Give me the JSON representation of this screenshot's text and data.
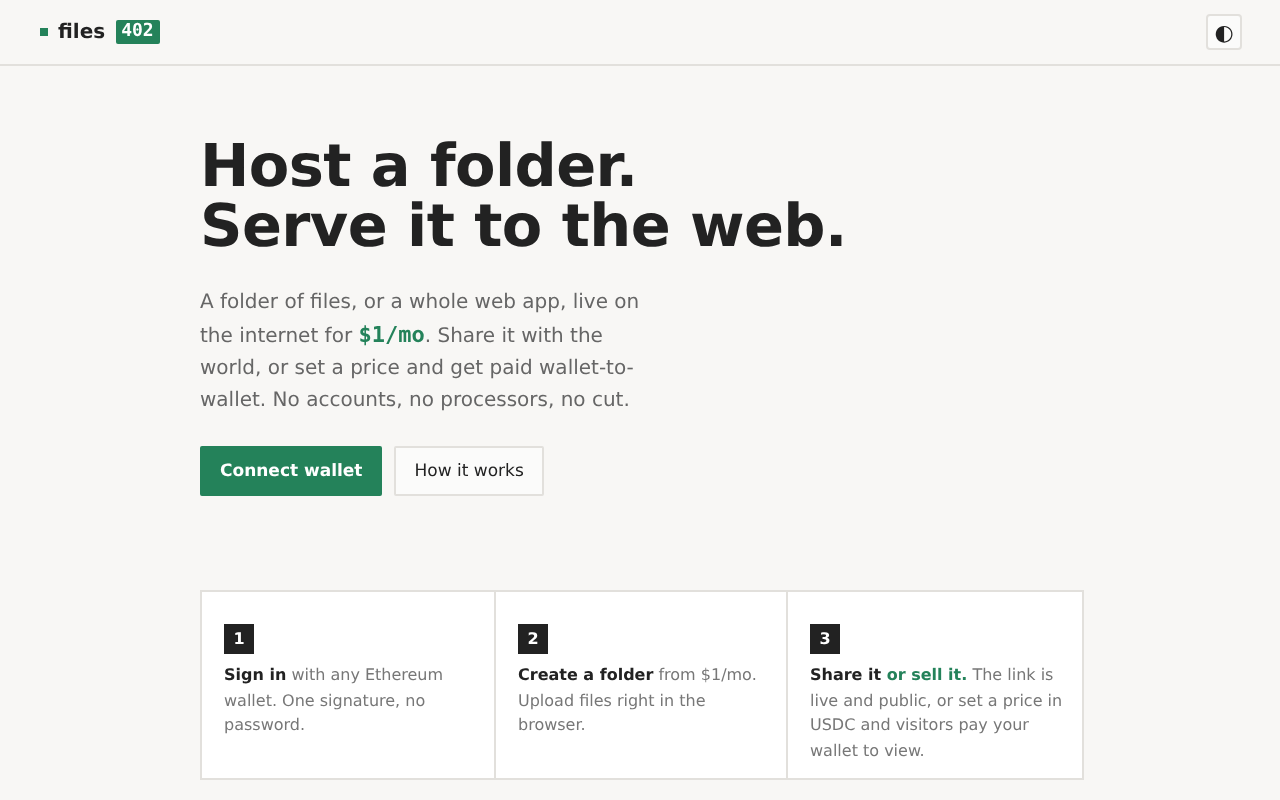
{
  "header": {
    "brand": "files",
    "badge": "402",
    "theme_toggle": "◐"
  },
  "hero": {
    "title_lines": [
      "Host a folder.",
      "Serve it to the web."
    ],
    "lead": [
      {
        "kind": "plain",
        "text": "A folder of files, or a whole web app, live on the internet for "
      },
      {
        "kind": "price",
        "text": "$1/mo"
      },
      {
        "kind": "plain",
        "text": ". Share it with the world, or set a price and get paid wallet-to-wallet. No accounts, no processors, no cut."
      }
    ],
    "buttons": [
      {
        "label": "Connect wallet",
        "kind": "primary"
      },
      {
        "label": "How it works",
        "kind": "secondary"
      }
    ]
  },
  "steps": [
    {
      "number": "1",
      "text": [
        {
          "kind": "strong",
          "text": "Sign in"
        },
        {
          "kind": "plain",
          "text": " with any Ethereum wallet. One signature, no password."
        }
      ]
    },
    {
      "number": "2",
      "text": [
        {
          "kind": "strong",
          "text": "Create a folder"
        },
        {
          "kind": "plain",
          "text": " from $1/mo. Upload files right in the browser."
        }
      ]
    },
    {
      "number": "3",
      "text": [
        {
          "kind": "strong",
          "text": "Share it"
        },
        {
          "kind": "accent",
          "text": " or sell it."
        },
        {
          "kind": "plain",
          "text": " The link is live and public, or set a price in USDC and visitors pay your wallet to view."
        }
      ]
    }
  ]
}
